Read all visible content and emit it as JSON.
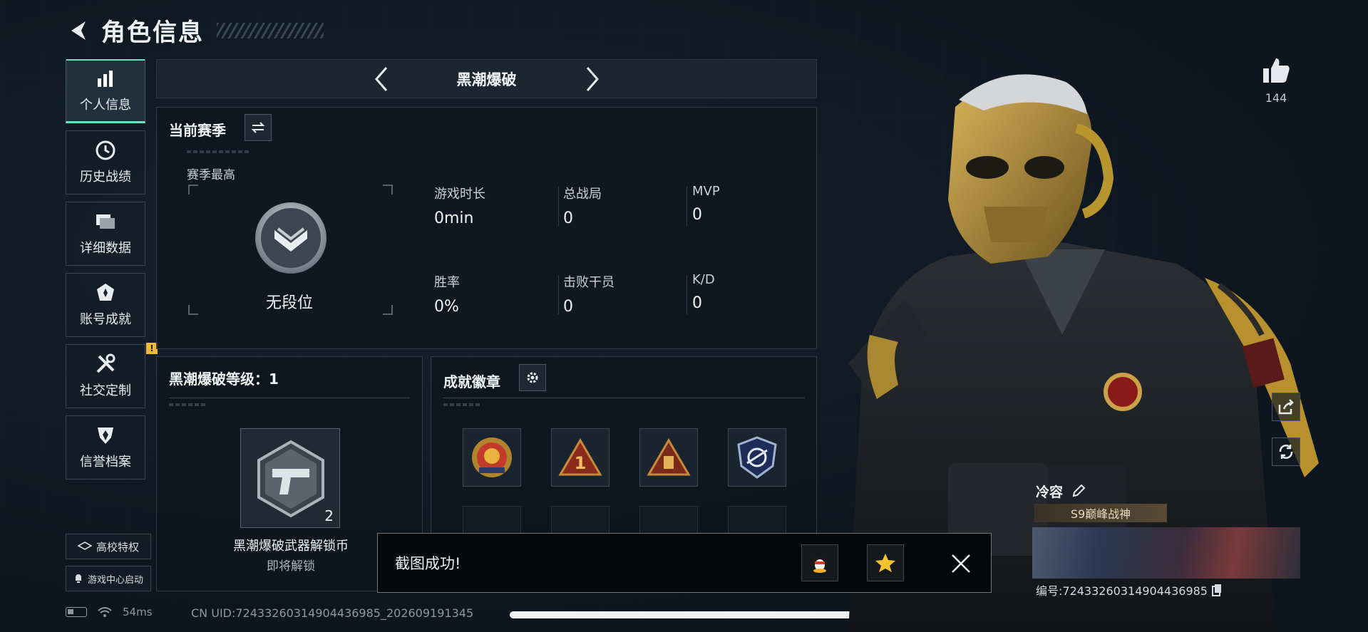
{
  "header": {
    "title": "角色信息"
  },
  "nav": {
    "items": [
      {
        "label": "个人信息",
        "icon": "bar-chart-icon",
        "active": true
      },
      {
        "label": "历史战绩",
        "icon": "clock-icon"
      },
      {
        "label": "详细数据",
        "icon": "folder-icon"
      },
      {
        "label": "账号成就",
        "icon": "achievement-icon"
      },
      {
        "label": "社交定制",
        "icon": "tools-icon",
        "badge": "!"
      },
      {
        "label": "信誉档案",
        "icon": "shield-icon"
      }
    ],
    "campus_label": "高校特权",
    "game_center_label": "游戏中心启动"
  },
  "status": {
    "ping": "54ms",
    "uid": "CN UID:7243326031490443698​5_202609191345"
  },
  "mode": {
    "name": "黑潮爆破"
  },
  "season": {
    "title": "当前赛季",
    "best_label": "赛季最高",
    "rank_name": "无段位",
    "stats": [
      {
        "label": "游戏时长",
        "value": "0min"
      },
      {
        "label": "总战局",
        "value": "0"
      },
      {
        "label": "MVP",
        "value": "0"
      },
      {
        "label": "胜率",
        "value": "0%"
      },
      {
        "label": "击败干员",
        "value": "0"
      },
      {
        "label": "K/D",
        "value": "0"
      }
    ]
  },
  "level": {
    "title": "黑潮爆破等级：1",
    "item_count": "2",
    "item_name": "黑潮爆破武器解锁币",
    "item_status": "即将解锁"
  },
  "badges": {
    "title": "成就徽章"
  },
  "toast": {
    "text": "截图成功!"
  },
  "profile": {
    "likes": "144",
    "player_name": "冷容",
    "title_tag": "S9巅峰战神",
    "id_label": "编号:7243326031490443698​5"
  },
  "colors": {
    "accent": "#6ee0c0",
    "warning": "#f0b93a",
    "gold": "#c8a24a"
  }
}
